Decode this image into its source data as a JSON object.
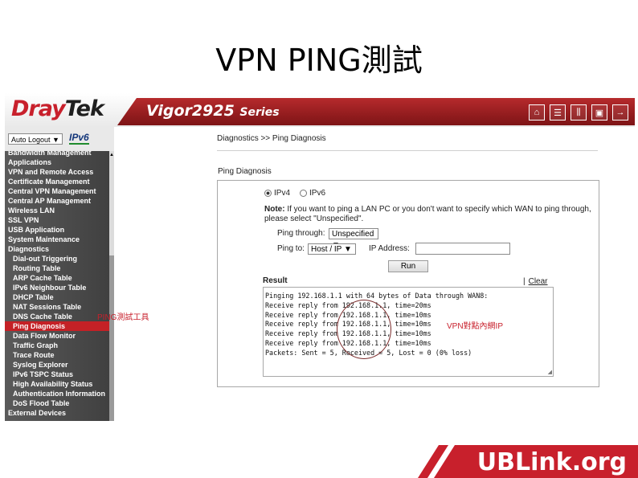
{
  "slide": {
    "title": "VPN PING測試"
  },
  "header": {
    "brand_left": "Dray",
    "brand_right": "Tek",
    "model": "Vigor2925",
    "series": "Series",
    "icons": [
      "home-icon",
      "list-icon",
      "settings-sliders-icon",
      "save-icon",
      "logout-icon"
    ]
  },
  "sidebar": {
    "logout_select": "Auto Logout ▼",
    "ipv6_logo": "IPv6",
    "items": [
      "Bandwidth Management",
      "Applications",
      "VPN and Remote Access",
      "Certificate Management",
      "Central VPN Management",
      "Central AP Management",
      "Wireless LAN",
      "SSL VPN",
      "USB Application",
      "System Maintenance",
      "Diagnostics",
      "Dial-out Triggering",
      "Routing Table",
      "ARP Cache Table",
      "IPv6 Neighbour Table",
      "DHCP Table",
      "NAT Sessions Table",
      "DNS Cache Table",
      "Ping Diagnosis",
      "Data Flow Monitor",
      "Traffic Graph",
      "Trace Route",
      "Syslog Explorer",
      "IPv6 TSPC Status",
      "High Availability Status",
      "Authentication Information",
      "DoS Flood Table",
      "External Devices"
    ]
  },
  "content": {
    "breadcrumb": "Diagnostics >> Ping Diagnosis",
    "section_title": "Ping Diagnosis",
    "radio_ipv4": "IPv4",
    "radio_ipv6": "IPv6",
    "note_label": "Note:",
    "note_text": " If you want to ping a LAN PC or you don't want to specify which WAN to ping through, please select \"Unspecified\".",
    "ping_through_label": "Ping through:",
    "ping_through_value": "Unspecified ▼",
    "ping_to_label": "Ping to:",
    "ping_to_value": "Host / IP ▼",
    "ip_address_label": "IP Address:",
    "ip_address_value": "",
    "run_label": "Run",
    "result_label": "Result",
    "separator": "|",
    "clear_label": "Clear",
    "result_lines": [
      "Pinging 192.168.1.1 with 64 bytes of Data through WAN8:",
      "Receive reply from 192.168.1.1, time=20ms",
      "Receive reply from 192.168.1.1, time=10ms",
      "Receive reply from 192.168.1.1, time=10ms",
      "Receive reply from 192.168.1.1, time=10ms",
      "Receive reply from 192.168.1.1, time=10ms",
      "Packets: Sent = 5, Received = 5, Lost = 0 (0% loss)"
    ]
  },
  "annotations": {
    "ping_tool": "PING測試工具",
    "vpn_ip": "VPN對點內網IP",
    "color": "#c8202c"
  },
  "banner": {
    "text": "UBLink.org",
    "color": "#c8202c"
  },
  "colors": {
    "active_nav": "#c42126",
    "header_bar": "#a82326"
  }
}
